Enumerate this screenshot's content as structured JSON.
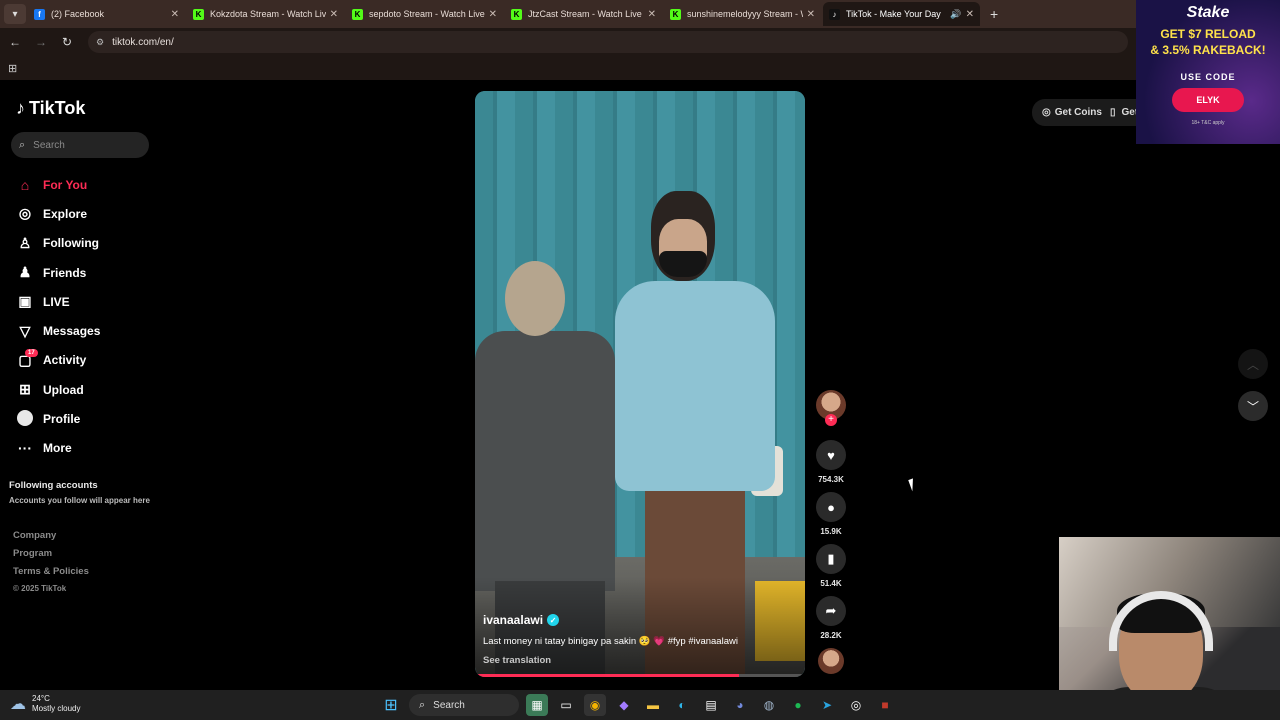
{
  "browser": {
    "tabs": [
      {
        "title": "(2) Facebook",
        "fav": "f",
        "color": "#1877f2",
        "active": false
      },
      {
        "title": "Kokzdota Stream - Watch Live o",
        "fav": "K",
        "color": "#53fc18",
        "active": false
      },
      {
        "title": "sepdoto Stream - Watch Live o",
        "fav": "K",
        "color": "#53fc18",
        "active": false
      },
      {
        "title": "JtzCast Stream - Watch Live on",
        "fav": "K",
        "color": "#53fc18",
        "active": false
      },
      {
        "title": "sunshinemelodyyy Stream - Wa",
        "fav": "K",
        "color": "#53fc18",
        "active": false
      },
      {
        "title": "TikTok - Make Your Day",
        "fav": "♪",
        "color": "#111111",
        "active": true
      }
    ],
    "url": "tiktok.com/en/"
  },
  "sidebar": {
    "logo": "TikTok",
    "search_placeholder": "Search",
    "nav": [
      {
        "label": "For You",
        "icon": "home-icon",
        "glyph": "⌂",
        "active": true
      },
      {
        "label": "Explore",
        "icon": "compass-icon",
        "glyph": "◎",
        "active": false
      },
      {
        "label": "Following",
        "icon": "following-icon",
        "glyph": "♙",
        "active": false
      },
      {
        "label": "Friends",
        "icon": "friends-icon",
        "glyph": "♟",
        "active": false
      },
      {
        "label": "LIVE",
        "icon": "live-icon",
        "glyph": "▣",
        "active": false
      },
      {
        "label": "Messages",
        "icon": "messages-icon",
        "glyph": "▽",
        "active": false
      },
      {
        "label": "Activity",
        "icon": "activity-icon",
        "glyph": "▢",
        "active": false,
        "badge": "17"
      },
      {
        "label": "Upload",
        "icon": "upload-icon",
        "glyph": "⊞",
        "active": false
      },
      {
        "label": "Profile",
        "icon": "profile-avatar",
        "glyph": "",
        "active": false
      },
      {
        "label": "More",
        "icon": "more-icon",
        "glyph": "···",
        "active": false
      }
    ],
    "following_heading": "Following accounts",
    "following_sub": "Accounts you follow will appear here",
    "footer": [
      "Company",
      "Program",
      "Terms & Policies"
    ],
    "copyright": "© 2025 TikTok"
  },
  "video": {
    "username": "ivanaalawi",
    "caption": "Last money ni tatay binigay pa sakin 🥺 💗 #fyp #ivanaalawi",
    "see_translation": "See translation",
    "progress": 0.8
  },
  "actions": {
    "likes": "754.3K",
    "comments": "15.9K",
    "saves": "51.4K",
    "shares": "28.2K"
  },
  "header": {
    "get_coins": "Get Coins",
    "get_app": "Get"
  },
  "ad": {
    "brand": "Stake",
    "line1": "GET $7 RELOAD",
    "line2": "& 3.5% RAKEBACK!",
    "code_label": "USE CODE",
    "code": "ELYK",
    "tc": "18+ T&C apply"
  },
  "taskbar": {
    "temp": "24°C",
    "weather": "Mostly cloudy",
    "search": "Search"
  }
}
